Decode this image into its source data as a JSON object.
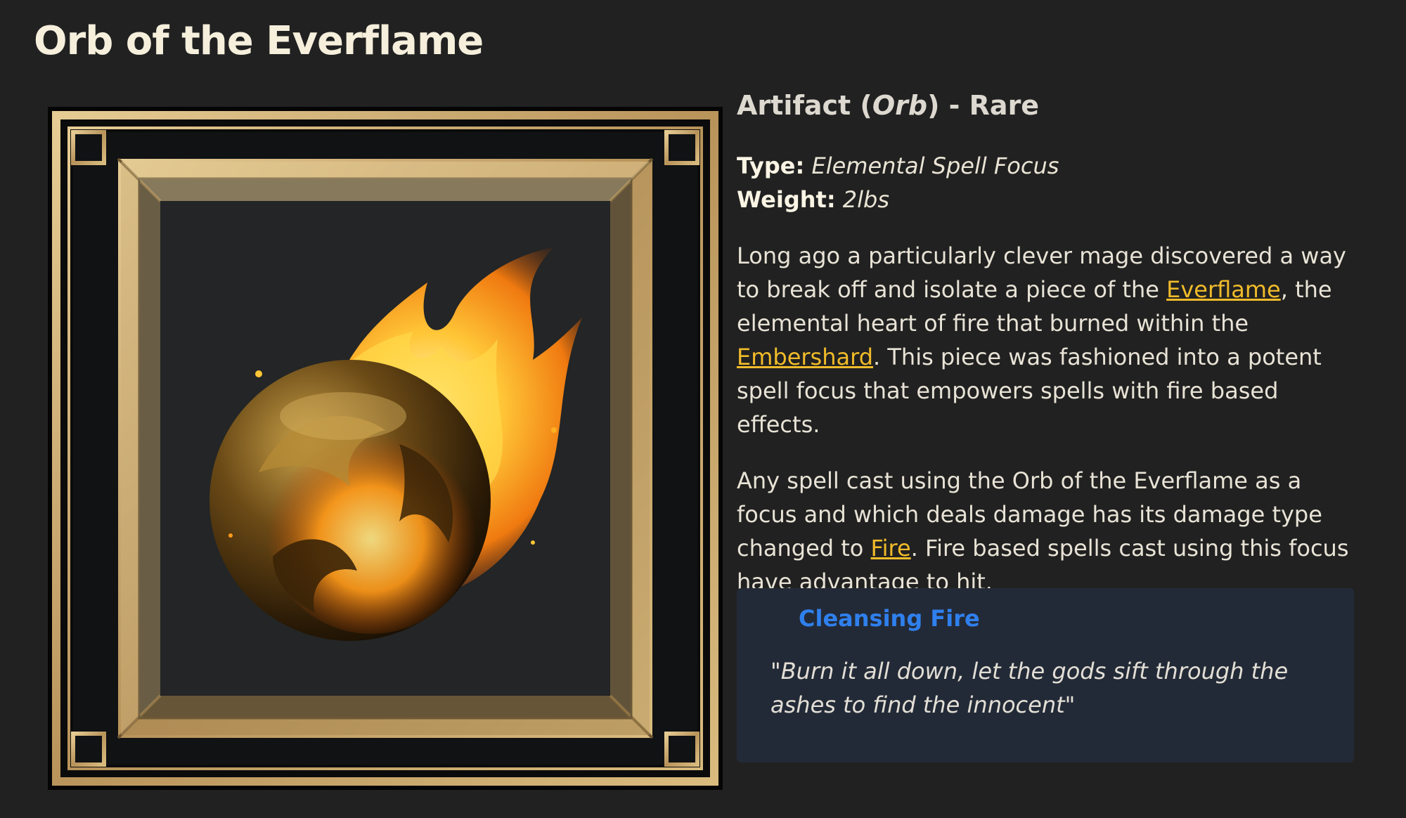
{
  "page": {
    "title": "Orb of the Everflame"
  },
  "item": {
    "subtitle_prefix": "Artifact (",
    "subtitle_category": "Orb",
    "subtitle_suffix": ") - Rare",
    "type_label": "Type:",
    "type_value": "Elemental Spell Focus",
    "weight_label": "Weight:",
    "weight_value": "2lbs"
  },
  "description": {
    "p1_a": "Long ago a particularly clever mage discovered a way to break off and isolate a piece of the ",
    "p1_link1": "Everflame",
    "p1_b": ", the elemental heart of fire that burned within the ",
    "p1_link2": "Embershard",
    "p1_c": ". This piece was fashioned into a potent spell focus that empowers spells with fire based effects.",
    "p2_a": "Any spell cast using the Orb of the Everflame as a focus and which deals damage has its damage type changed to ",
    "p2_link": "Fire",
    "p2_b": ". Fire based spells cast using this focus have advantage to hit."
  },
  "callout": {
    "title": "Cleansing Fire",
    "quote": "\"Burn it all down, let the gods sift through the ashes to find the innocent\""
  },
  "colors": {
    "background": "#212121",
    "link": "#f0bb2a",
    "callout_title": "#2f80ed",
    "callout_bg": "#232a37",
    "frame_gold": "#c9a86a"
  },
  "image": {
    "icon": "flaming-orb-artwork"
  }
}
